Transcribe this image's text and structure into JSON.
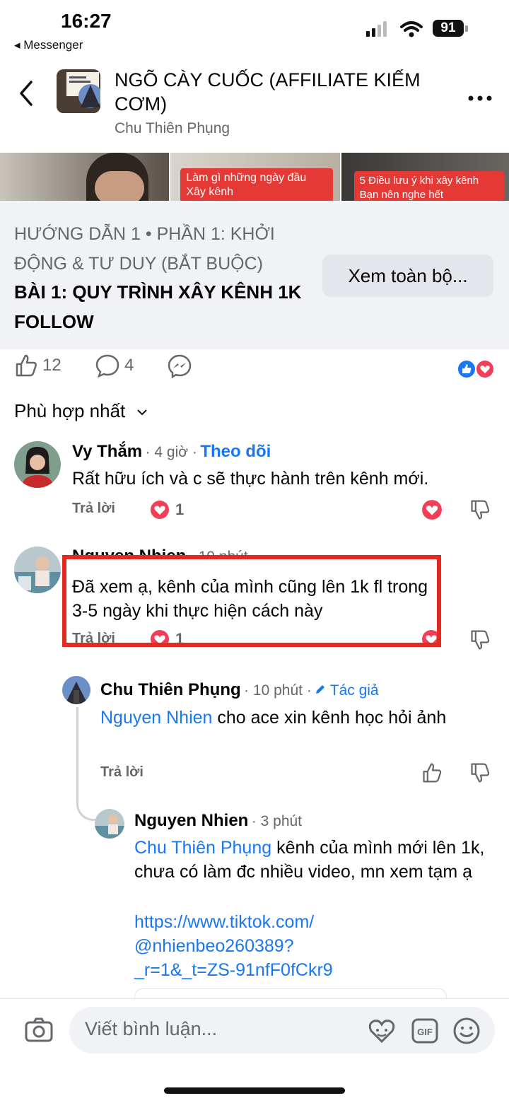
{
  "status_bar": {
    "time": "16:27",
    "back_app": "◂ Messenger",
    "battery": "91"
  },
  "header": {
    "group_name": "NGÕ CÀY CUỐC (AFFILIATE KIẾM CƠM)",
    "subtitle": "Chu Thiên Phụng"
  },
  "thumbnails": [
    {
      "caption": ""
    },
    {
      "caption": "Làm gì những ngày đầu Xây kênh"
    },
    {
      "caption": "5 Điều lưu ý khi xây kênh Bạn nên nghe hết"
    }
  ],
  "post": {
    "section": "HƯỚNG DẪN 1 • PHẦN 1: KHỞI ĐỘNG & TƯ DUY (BẮT BUỘC)",
    "title": "BÀI 1: QUY TRÌNH XÂY KÊNH 1K FOLLOW",
    "see_all": "Xem toàn bộ..."
  },
  "stats": {
    "likes": "12",
    "comments": "4"
  },
  "sort_label": "Phù hợp nhất",
  "comments": [
    {
      "name": "Vy Thắm",
      "time": "· 4 giờ ·",
      "follow": "Theo dõi",
      "text": "Rất hữu ích và c sẽ thực hành trên kênh mới.",
      "reply": "Trả lời",
      "hearts": "1"
    },
    {
      "name": "Nguyen Nhien",
      "time": "· 10 phút",
      "text": "Đã xem ạ, kênh của mình cũng lên 1k fl trong 3-5 ngày khi thực hiện cách này",
      "reply": "Trả lời",
      "hearts": "1"
    },
    {
      "name": "Chu Thiên Phụng",
      "time": "· 10 phút ·",
      "badge": "Tác giả",
      "mention": "Nguyen Nhien",
      "text": " cho ace xin kênh học hỏi ảnh",
      "reply": "Trả lời"
    },
    {
      "name": "Nguyen Nhien",
      "time": "· 3 phút",
      "mention": "Chu Thiên Phụng",
      "text": " kênh của mình mới lên 1k, chưa có làm đc nhiều video, mn xem tạm ạ",
      "link": "https://www.tiktok.com/@nhienbeo260389?_r=1&_t=ZS-91nfF0fCkr9",
      "link_lines": [
        "https://www.tiktok.com/",
        "@nhienbeo260389?",
        "_r=1&_t=ZS-91nfF0fCkr9"
      ]
    }
  ],
  "composer": {
    "placeholder": "Viết bình luận..."
  },
  "colors": {
    "accent": "#1877f2",
    "love": "#f33e58",
    "highlight": "#e32a1e"
  }
}
